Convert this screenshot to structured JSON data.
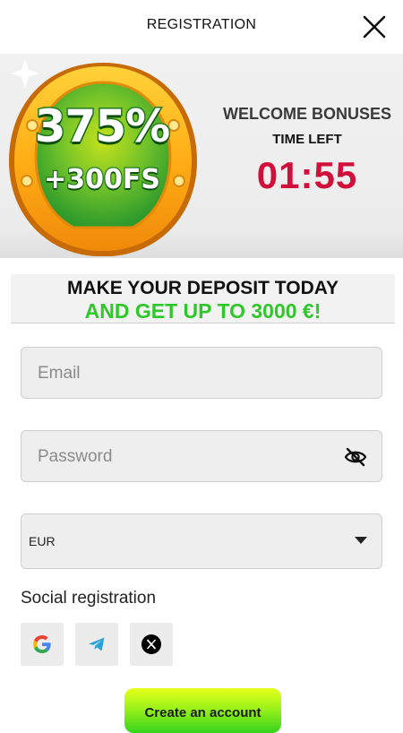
{
  "header": {
    "title": "REGISTRATION"
  },
  "banner": {
    "promo_percent": "375%",
    "promo_spins": "+300FS",
    "welcome_title": "WELCOME BONUSES",
    "time_left_label": "TIME LEFT",
    "timer": "01:55"
  },
  "offer": {
    "line1": "MAKE YOUR DEPOSIT TODAY",
    "line2": "AND GET UP TO 3000 €!"
  },
  "form": {
    "email_placeholder": "Email",
    "password_placeholder": "Password",
    "currency_value": "EUR"
  },
  "social": {
    "label": "Social registration",
    "providers": [
      "google-icon",
      "telegram-icon",
      "x-icon"
    ]
  },
  "cta": {
    "label": "Create an account"
  },
  "colors": {
    "timer": "#d0103a",
    "offer_accent": "#2fc72a",
    "cta_top": "#e6ff1a",
    "cta_bottom": "#35d21c"
  }
}
